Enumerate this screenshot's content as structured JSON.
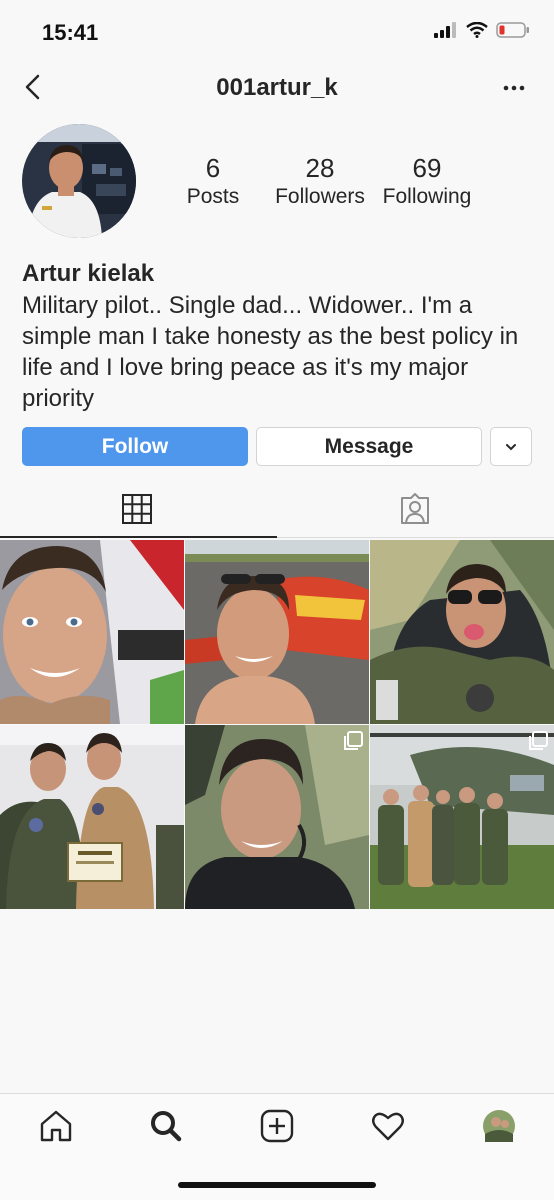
{
  "status_bar": {
    "time": "15:41"
  },
  "nav": {
    "username": "001artur_k"
  },
  "stats": [
    {
      "value": "6",
      "label": "Posts"
    },
    {
      "value": "28",
      "label": "Followers"
    },
    {
      "value": "69",
      "label": "Following"
    }
  ],
  "profile": {
    "name": "Artur kielak",
    "bio": "Military pilot.. Single dad... Widower.. I'm a simple man I take honesty as the best policy in life and I love bring peace as it's my major priority"
  },
  "actions": {
    "follow": "Follow",
    "message": "Message"
  },
  "colors": {
    "accent": "#4e97ec"
  },
  "icons": [
    "back-icon",
    "more-icon",
    "grid-icon",
    "tagged-icon",
    "home-icon",
    "search-icon",
    "add-icon",
    "heart-icon"
  ]
}
